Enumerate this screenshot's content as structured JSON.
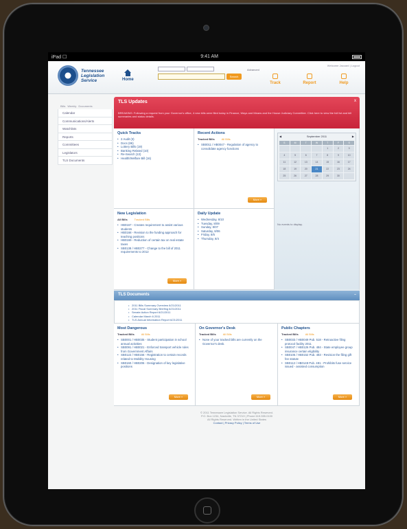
{
  "device": {
    "status_left": "iPad ☐",
    "time": "9:41 AM"
  },
  "header": {
    "logo_text": "Tennessee Legislation Service",
    "home_label": "Home",
    "search_select_1": "",
    "search_select_2": "",
    "search_button": "Search",
    "advanced_label": "Advanced",
    "top_links": "Welcome Jaccard | Logout",
    "nav": [
      {
        "label": "Track"
      },
      {
        "label": "Report"
      },
      {
        "label": "Help"
      }
    ]
  },
  "sidebar": {
    "tabs": [
      "Bills",
      "Weekly",
      "Documents"
    ],
    "items": [
      "Calendar",
      "Communications/Alerts",
      "Watchlists",
      "Reports",
      "Committees",
      "Legislators",
      "TLS Documents"
    ]
  },
  "updates": {
    "title": "TLS Updates",
    "text": "BREAKING: Following a request from your Governor's office, 4 new bills were filed today in Finance, Ways and Means and the House Judiciary Committee. Click here to view the full list and bill summaries and status details.",
    "close": "x"
  },
  "quick_tracks": {
    "title": "Quick Tracks",
    "items": [
      "2 Audit (3)",
      "Docs (86)",
      "Lottery Bills (19)",
      "Banking Related (10)",
      "Re-Search (13)",
      "Health/Welfare Bill (16)"
    ]
  },
  "recent_actions": {
    "title": "Recent Actions",
    "tab_a": "Tracked Bills",
    "tab_b": "All Bills",
    "items": [
      "SB0011 / HB0047 - Regulation of agency to consolidate agency functions"
    ],
    "more": "More »"
  },
  "calendar": {
    "month": "September 2011",
    "dow": [
      "S",
      "M",
      "T",
      "W",
      "T",
      "F",
      "S"
    ],
    "days": [
      "",
      "",
      "",
      "",
      "1",
      "2",
      "3",
      "4",
      "5",
      "6",
      "7",
      "8",
      "9",
      "10",
      "11",
      "12",
      "13",
      "14",
      "15",
      "16",
      "17",
      "18",
      "19",
      "20",
      "21",
      "22",
      "23",
      "24",
      "25",
      "26",
      "27",
      "28",
      "29",
      "30",
      ""
    ],
    "selected": "21",
    "note": "No events to display."
  },
  "new_legislation": {
    "title": "New Legislation",
    "tab_a": "All Bills",
    "tab_b": "Tracked Bills",
    "items": [
      "HB0167 - Creates requirement to assist various students",
      "HB0168 - Revision to the funding approach for teaching positions",
      "HB0169 - Reduction of certain tax on real estate taxes",
      "SB0138 / HB0277 - Change to the bill of 2011 requirements to 2012"
    ],
    "more": "More »"
  },
  "daily_update": {
    "title": "Daily Update",
    "items": [
      "Wednesday, 8/10",
      "Tuesday, 8/09",
      "Sunday, 8/07",
      "Saturday, 8/06",
      "Friday, 8/5",
      "Thursday, 8/4"
    ]
  },
  "documents": {
    "title": "TLS Documents",
    "min": "−",
    "items": [
      "2011 Bills Summary Overview 6/21/2011",
      "2011 Fiscal Summary Briefing 6/21/2011",
      "Senate Action Report 6/21/2011",
      "Calendar March 6 2011",
      "TLS Annual Information Report 6/21/2011"
    ]
  },
  "most_dangerous": {
    "title": "Most Dangerous",
    "tab_a": "Tracked Bills",
    "tab_b": "All Bills",
    "items": [
      "SB0001 / HB0035 - Student participation in school annual activities",
      "SB0091 / HB0021 - Enforced transport vehicle rules from Government Affairs",
      "SB0122 / HB0156 - Registration to certain records related to Mobility Housing",
      "SB0160 / HB0206 - Designation of key legislative positions"
    ],
    "more": "More »"
  },
  "governors_desk": {
    "title": "On Governor's Desk",
    "tab_a": "Tracked Bills",
    "tab_b": "All Bills",
    "items": [
      "None of your tracked bills are currently on the Governor's desk."
    ],
    "more": "More »"
  },
  "public_chapters": {
    "title": "Public Chapters",
    "tab_a": "Tracked Bills",
    "tab_b": "All Bills",
    "items": [
      "SB0033 / HB0049 Pub. 518 - Retroactive filing protocol facility 2011",
      "SB0047 / HB0126 Pub. 484 - State employee group insurance certain eligibility",
      "SB0106 / HB0152 Pub. 483 - Revision the filing gift fee statute",
      "SB0112 / HB0148 Pub. 481 - Prohibits fuse service issued - assisted consumption"
    ],
    "more": "More »"
  },
  "footer": {
    "line1": "© 2011 Tennessee Legislation Service. All Rights Reserved.",
    "line2": "P.O. Box 1234, Nashville, TN 37219 | Phone 615.555.0100",
    "line3": "All Rights Reserved. Written in the United States",
    "links": "Contact | Privacy Policy | Terms of Use"
  }
}
